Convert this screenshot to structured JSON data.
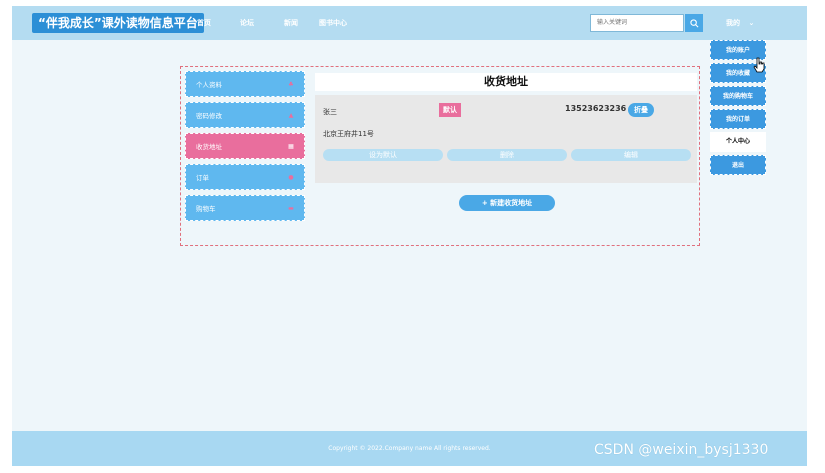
{
  "header": {
    "brand": "“伴我成长”课外读物信息平台",
    "nav": [
      "首页",
      "论坛",
      "新闻",
      "图书中心"
    ],
    "search_placeholder": "输入关键词",
    "mine_label": "我的",
    "mine_chevron": "⌄"
  },
  "dropdown": {
    "items": [
      "我的账户",
      "我的收藏",
      "我的购物车",
      "我的订单",
      "个人中心",
      "退出"
    ]
  },
  "sidebar": {
    "items": [
      {
        "label": "个人资料",
        "icon": "user-icon",
        "glyph": "♣"
      },
      {
        "label": "密码修改",
        "icon": "lock-icon",
        "glyph": "▲"
      },
      {
        "label": "收货地址",
        "icon": "location-icon",
        "glyph": "▦"
      },
      {
        "label": "订单",
        "icon": "order-icon",
        "glyph": "●"
      },
      {
        "label": "购物车",
        "icon": "cart-icon",
        "glyph": "▬"
      }
    ]
  },
  "main": {
    "title": "收货地址",
    "address": {
      "name": "张三",
      "default_badge": "默认",
      "phone": "13523623236",
      "tag": "折叠",
      "detail": "北京王府井11号"
    },
    "actions": [
      "设为默认",
      "删除",
      "编辑"
    ],
    "new_button": "+ 新建收货地址"
  },
  "footer": {
    "copyright": "Copyright © 2022.Company name All rights reserved.",
    "watermark": "CSDN @weixin_bysj1330"
  },
  "colors": {
    "accent": "#4aa8e6",
    "pink": "#e96e9d",
    "topbar": "#b4dcf1"
  }
}
